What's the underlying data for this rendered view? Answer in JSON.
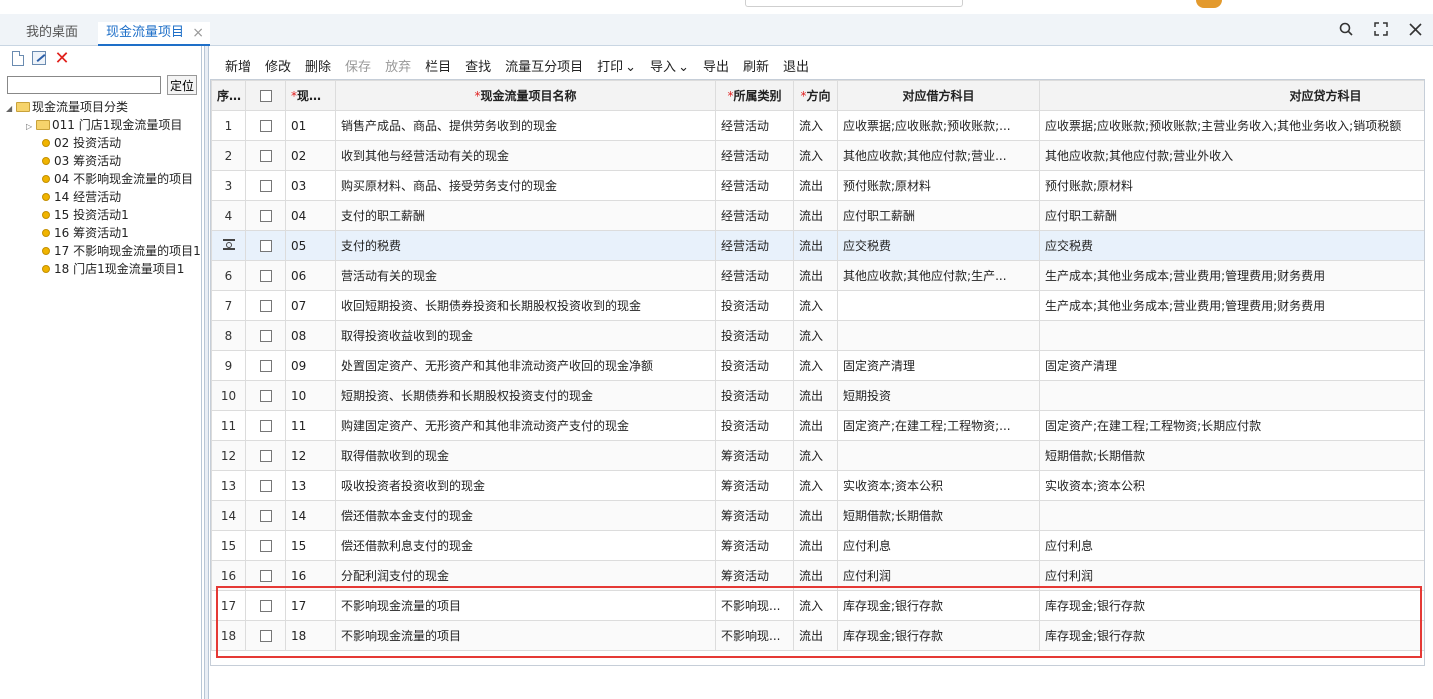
{
  "tabs": {
    "home": "我的桌面",
    "active": "现金流量项目",
    "close": "×"
  },
  "window": {
    "search_icon": "search-icon",
    "fullscreen_icon": "fullscreen-icon",
    "close_icon": "close-icon"
  },
  "left": {
    "tools": [
      "new-doc-icon",
      "edit-icon",
      "delete-icon"
    ],
    "search_value": "",
    "locate_label": "定位",
    "tree": {
      "root": "现金流量项目分类",
      "items": [
        {
          "label": "011 门店1现金流量项目",
          "type": "folder"
        },
        {
          "label": "02 投资活动",
          "type": "leaf"
        },
        {
          "label": "03 筹资活动",
          "type": "leaf"
        },
        {
          "label": "04 不影响现金流量的项目",
          "type": "leaf"
        },
        {
          "label": "14 经营活动",
          "type": "leaf"
        },
        {
          "label": "15 投资活动1",
          "type": "leaf"
        },
        {
          "label": "16 筹资活动1",
          "type": "leaf"
        },
        {
          "label": "17 不影响现金流量的项目1",
          "type": "leaf"
        },
        {
          "label": "18 门店1现金流量项目1",
          "type": "leaf"
        }
      ]
    }
  },
  "toolbar": [
    "新增",
    "修改",
    "删除",
    "保存",
    "放弃",
    "栏目",
    "查找",
    "流量互分项目",
    "打印",
    "导入",
    "导出",
    "刷新",
    "退出"
  ],
  "toolbar_menu_indicator": "⌄",
  "grid": {
    "headers": {
      "seq": "序号",
      "code": "现金...",
      "name": "现金流量项目名称",
      "category": "所属类别",
      "direction": "方向",
      "debit": "对应借方科目",
      "credit": "对应贷方科目"
    },
    "rows": [
      {
        "seq": "1",
        "code": "01",
        "name": "销售产成品、商品、提供劳务收到的现金",
        "category": "经营活动",
        "direction": "流入",
        "debit": "应收票据;应收账款;预收账款;...",
        "credit": "应收票据;应收账款;预收账款;主营业务收入;其他业务收入;销项税额"
      },
      {
        "seq": "2",
        "code": "02",
        "name": "收到其他与经营活动有关的现金",
        "category": "经营活动",
        "direction": "流入",
        "debit": "其他应收款;其他应付款;营业...",
        "credit": "其他应收款;其他应付款;营业外收入"
      },
      {
        "seq": "3",
        "code": "03",
        "name": "购买原材料、商品、接受劳务支付的现金",
        "category": "经营活动",
        "direction": "流出",
        "debit": "预付账款;原材料",
        "credit": "预付账款;原材料"
      },
      {
        "seq": "4",
        "code": "04",
        "name": "支付的职工薪酬",
        "category": "经营活动",
        "direction": "流出",
        "debit": "应付职工薪酬",
        "credit": "应付职工薪酬"
      },
      {
        "seq": "",
        "code": "05",
        "name": "支付的税费",
        "category": "经营活动",
        "direction": "流出",
        "debit": "应交税费",
        "credit": "应交税费"
      },
      {
        "seq": "6",
        "code": "06",
        "name": "营活动有关的现金",
        "category": "经营活动",
        "direction": "流出",
        "debit": "其他应收款;其他应付款;生产...",
        "credit": "生产成本;其他业务成本;营业费用;管理费用;财务费用"
      },
      {
        "seq": "7",
        "code": "07",
        "name": "收回短期投资、长期债券投资和长期股权投资收到的现金",
        "category": "投资活动",
        "direction": "流入",
        "debit": "",
        "credit": "生产成本;其他业务成本;营业费用;管理费用;财务费用"
      },
      {
        "seq": "8",
        "code": "08",
        "name": "取得投资收益收到的现金",
        "category": "投资活动",
        "direction": "流入",
        "debit": "",
        "credit": ""
      },
      {
        "seq": "9",
        "code": "09",
        "name": "处置固定资产、无形资产和其他非流动资产收回的现金净额",
        "category": "投资活动",
        "direction": "流入",
        "debit": "固定资产清理",
        "credit": "固定资产清理"
      },
      {
        "seq": "10",
        "code": "10",
        "name": "短期投资、长期债券和长期股权投资支付的现金",
        "category": "投资活动",
        "direction": "流出",
        "debit": "短期投资",
        "credit": ""
      },
      {
        "seq": "11",
        "code": "11",
        "name": "购建固定资产、无形资产和其他非流动资产支付的现金",
        "category": "投资活动",
        "direction": "流出",
        "debit": "固定资产;在建工程;工程物资;...",
        "credit": "固定资产;在建工程;工程物资;长期应付款"
      },
      {
        "seq": "12",
        "code": "12",
        "name": "取得借款收到的现金",
        "category": "筹资活动",
        "direction": "流入",
        "debit": "",
        "credit": "短期借款;长期借款"
      },
      {
        "seq": "13",
        "code": "13",
        "name": "吸收投资者投资收到的现金",
        "category": "筹资活动",
        "direction": "流入",
        "debit": "实收资本;资本公积",
        "credit": "实收资本;资本公积"
      },
      {
        "seq": "14",
        "code": "14",
        "name": "偿还借款本金支付的现金",
        "category": "筹资活动",
        "direction": "流出",
        "debit": "短期借款;长期借款",
        "credit": ""
      },
      {
        "seq": "15",
        "code": "15",
        "name": "偿还借款利息支付的现金",
        "category": "筹资活动",
        "direction": "流出",
        "debit": "应付利息",
        "credit": "应付利息"
      },
      {
        "seq": "16",
        "code": "16",
        "name": "分配利润支付的现金",
        "category": "筹资活动",
        "direction": "流出",
        "debit": "应付利润",
        "credit": "应付利润"
      },
      {
        "seq": "17",
        "code": "17",
        "name": "不影响现金流量的项目",
        "category": "不影响现...",
        "direction": "流入",
        "debit": "库存现金;银行存款",
        "credit": "库存现金;银行存款"
      },
      {
        "seq": "18",
        "code": "18",
        "name": "不影响现金流量的项目",
        "category": "不影响现...",
        "direction": "流出",
        "debit": "库存现金;银行存款",
        "credit": "库存现金;银行存款"
      }
    ]
  }
}
